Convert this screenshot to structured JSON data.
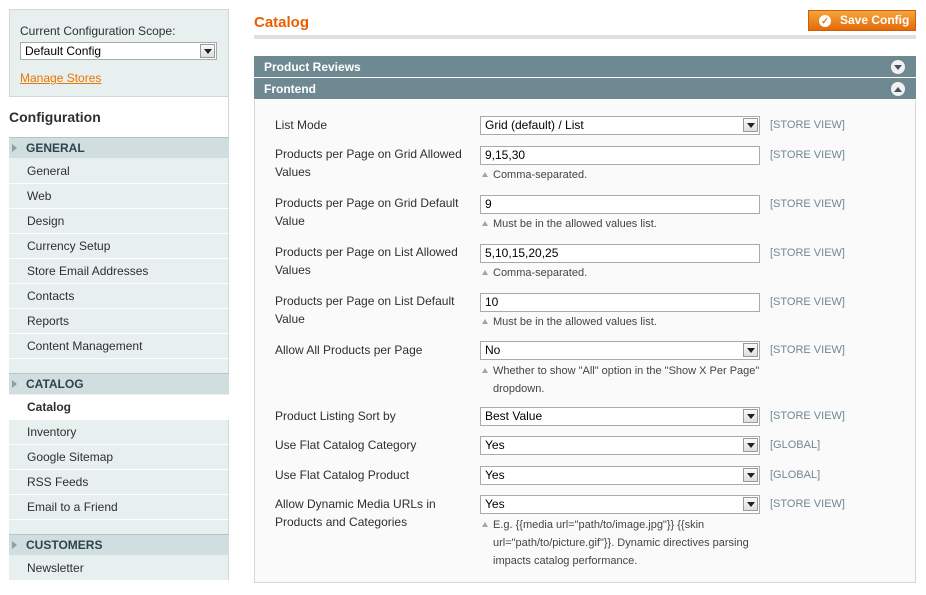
{
  "sidebar": {
    "scope_label": "Current Configuration Scope:",
    "scope_value": "Default Config",
    "manage_stores": "Manage Stores",
    "config_title": "Configuration",
    "groups": [
      {
        "label": "GENERAL",
        "items": [
          "General",
          "Web",
          "Design",
          "Currency Setup",
          "Store Email Addresses",
          "Contacts",
          "Reports",
          "Content Management"
        ]
      },
      {
        "label": "CATALOG",
        "items": [
          "Catalog",
          "Inventory",
          "Google Sitemap",
          "RSS Feeds",
          "Email to a Friend"
        ]
      },
      {
        "label": "CUSTOMERS",
        "items": [
          "Newsletter"
        ]
      }
    ]
  },
  "header": {
    "title": "Catalog",
    "save_label": "Save Config"
  },
  "sections": {
    "product_reviews": "Product Reviews",
    "frontend": "Frontend"
  },
  "fields": [
    {
      "label": "List Mode",
      "value": "Grid (default) / List",
      "scope": "[STORE VIEW]"
    },
    {
      "label": "Products per Page on Grid Allowed Values",
      "value": "9,15,30",
      "scope": "[STORE VIEW]",
      "note": "Comma-separated."
    },
    {
      "label": "Products per Page on Grid Default Value",
      "value": "9",
      "scope": "[STORE VIEW]",
      "note": "Must be in the allowed values list."
    },
    {
      "label": "Products per Page on List Allowed Values",
      "value": "5,10,15,20,25",
      "scope": "[STORE VIEW]",
      "note": "Comma-separated."
    },
    {
      "label": "Products per Page on List Default Value",
      "value": "10",
      "scope": "[STORE VIEW]",
      "note": "Must be in the allowed values list."
    },
    {
      "label": "Allow All Products per Page",
      "value": "No",
      "scope": "[STORE VIEW]",
      "note": "Whether to show \"All\" option in the \"Show X Per Page\" dropdown."
    },
    {
      "label": "Product Listing Sort by",
      "value": "Best Value",
      "scope": "[STORE VIEW]"
    },
    {
      "label": "Use Flat Catalog Category",
      "value": "Yes",
      "scope": "[GLOBAL]"
    },
    {
      "label": "Use Flat Catalog Product",
      "value": "Yes",
      "scope": "[GLOBAL]"
    },
    {
      "label": "Allow Dynamic Media URLs in Products and Categories",
      "value": "Yes",
      "scope": "[STORE VIEW]",
      "note": "E.g. {{media url=\"path/to/image.jpg\"}} {{skin url=\"path/to/picture.gif\"}}. Dynamic directives parsing impacts catalog performance."
    }
  ],
  "colors": {
    "accent": "#eb5e00",
    "section_header": "#6f8992",
    "sidebar_bg": "#e7efef",
    "group_bg": "#d1dedf"
  }
}
